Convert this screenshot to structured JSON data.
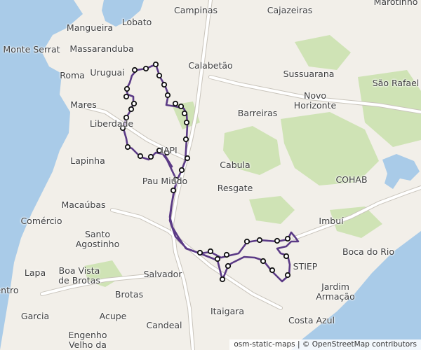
{
  "map": {
    "attribution": "osm-static-maps | © OpenStreetMap contributors",
    "colors": {
      "water": "#a9cbe8",
      "land": "#f2efe9",
      "green": "#cfe3b5",
      "road_major": "#ffffff",
      "road_outline": "#c9c4bb",
      "route": "#5b3a86",
      "marker_fill": "#ffffff",
      "marker_stroke": "#111111"
    },
    "place_labels": [
      {
        "name": "Campinas"
      },
      {
        "name": "Cajazeiras"
      },
      {
        "name": "Marotinho"
      },
      {
        "name": "Mangueira"
      },
      {
        "name": "Lobato"
      },
      {
        "name": "Monte Serrat"
      },
      {
        "name": "Massaranduba"
      },
      {
        "name": "Calabetão"
      },
      {
        "name": "Sussuarana"
      },
      {
        "name": "Roma"
      },
      {
        "name": "Uruguai"
      },
      {
        "name": "São Rafael"
      },
      {
        "name": "Novo\nHorizonte"
      },
      {
        "name": "Mares"
      },
      {
        "name": "Barreiras"
      },
      {
        "name": "Liberdade"
      },
      {
        "name": "COHAB"
      },
      {
        "name": "IAPI"
      },
      {
        "name": "Lapinha"
      },
      {
        "name": "Cabula"
      },
      {
        "name": "Pau Miúdo"
      },
      {
        "name": "Resgate"
      },
      {
        "name": "Macaúbas"
      },
      {
        "name": "Imbuí"
      },
      {
        "name": "Comércio"
      },
      {
        "name": "Santo\nAgostinho"
      },
      {
        "name": "Boca do Rio"
      },
      {
        "name": "STIEP"
      },
      {
        "name": "Lapa"
      },
      {
        "name": "Boa Vista\nde Brotas"
      },
      {
        "name": "Salvador"
      },
      {
        "name": "Jardim\nArmação"
      },
      {
        "name": "Brotas"
      },
      {
        "name": "entro"
      },
      {
        "name": "Garcia"
      },
      {
        "name": "Acupe"
      },
      {
        "name": "Itaigara"
      },
      {
        "name": "Costa Azul"
      },
      {
        "name": "Candeal"
      },
      {
        "name": "Engenho\nVelho da"
      }
    ],
    "route": {
      "stops": 40
    }
  }
}
